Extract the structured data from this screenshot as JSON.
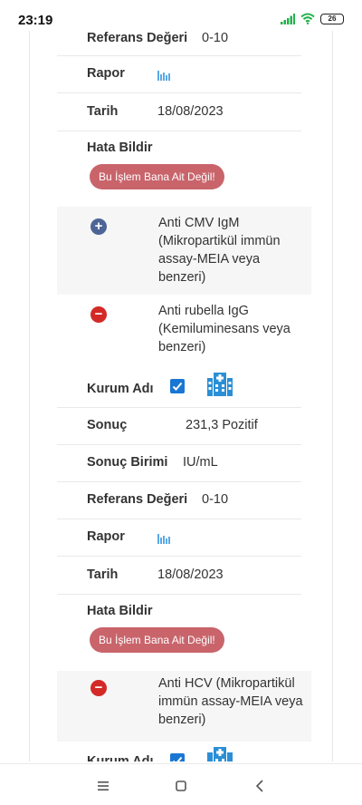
{
  "status_bar": {
    "time": "23:19",
    "battery": "26"
  },
  "labels": {
    "reference": "Referans Değeri",
    "report": "Rapor",
    "date": "Tarih",
    "report_error": "Hata Bildir",
    "institution": "Kurum Adı",
    "result": "Sonuç",
    "result_unit": "Sonuç Birimi"
  },
  "error_button_label": "Bu İşlem Bana Ait Değil!",
  "top_record": {
    "reference_value": "0-10",
    "date": "18/08/2023"
  },
  "tests": [
    {
      "name": "Anti CMV IgM (Mikropartikül immün assay-MEIA veya benzeri)",
      "expanded": false
    },
    {
      "name": "Anti rubella IgG (Kemiluminesans veya benzeri)",
      "expanded": true,
      "institution_checked": true,
      "result": "231,3 Pozitif",
      "unit": "IU/mL",
      "reference_value": "0-10",
      "date": "18/08/2023"
    },
    {
      "name": "Anti HCV (Mikropartikül immün assay-MEIA veya benzeri)",
      "expanded": true
    }
  ],
  "icons": {
    "report": "bar-chart-icon",
    "institution": "hospital-building-icon",
    "expand": "plus-circle-icon",
    "collapse": "minus-circle-icon"
  },
  "colors": {
    "accent_blue": "#1977d3",
    "chart_icon": "#5aa9e6",
    "error_button": "#c9646b",
    "collapse_red": "#d42a27",
    "expand_blue": "#4d6496"
  }
}
